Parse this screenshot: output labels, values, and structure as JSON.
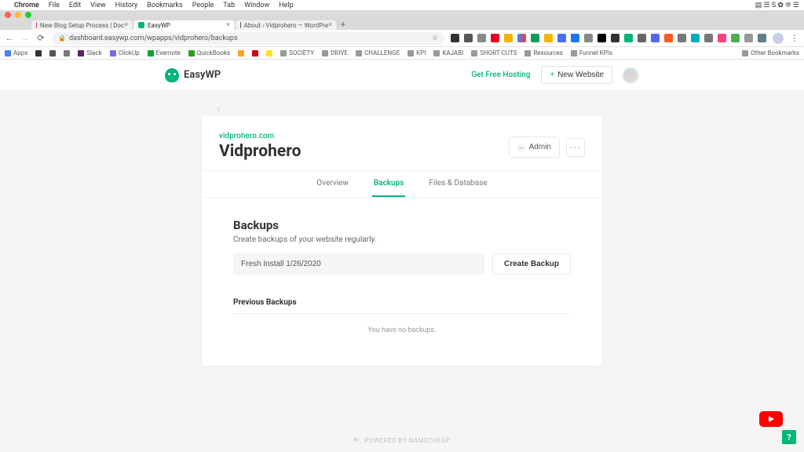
{
  "macmenu": {
    "app": "Chrome",
    "items": [
      "File",
      "Edit",
      "View",
      "History",
      "Bookmarks",
      "People",
      "Tab",
      "Window",
      "Help"
    ]
  },
  "tabs": [
    {
      "title": "New Blog Setup Process | Doc",
      "active": false
    },
    {
      "title": "EasyWP",
      "active": true
    },
    {
      "title": "About ‹ Vidprohero — WordPre",
      "active": false
    }
  ],
  "url": "dashboard.easywp.com/wpapps/vidprohero/backups",
  "bookmarks": [
    "Apps",
    "",
    "",
    "",
    "Slack",
    "ClickUp",
    "Evernote",
    "QuickBooks",
    "",
    "",
    "",
    "SOCIETY",
    "DRIVE",
    "CHALLENGE",
    "KPI",
    "KAJABI",
    "SHORT CUTS",
    "Resources",
    "Funnel KPIs"
  ],
  "bookmarks_right": "Other Bookmarks",
  "header": {
    "brand": "EasyWP",
    "hosting": "Get Free Hosting",
    "newsite": "New Website"
  },
  "page": {
    "domain": "vidprohero.com",
    "site_name": "Vidprohero",
    "admin": "Admin",
    "tabs": {
      "overview": "Overview",
      "backups": "Backups",
      "files": "Files & Database"
    },
    "section": {
      "title": "Backups",
      "subtitle": "Create backups of your website regularly."
    },
    "backup_input": "Fresh Install 1/26/2020",
    "create_btn": "Create Backup",
    "prev_title": "Previous Backups",
    "no_backups": "You have no backups."
  },
  "footer": "POWERED BY NAMECHEAP",
  "help": "?"
}
